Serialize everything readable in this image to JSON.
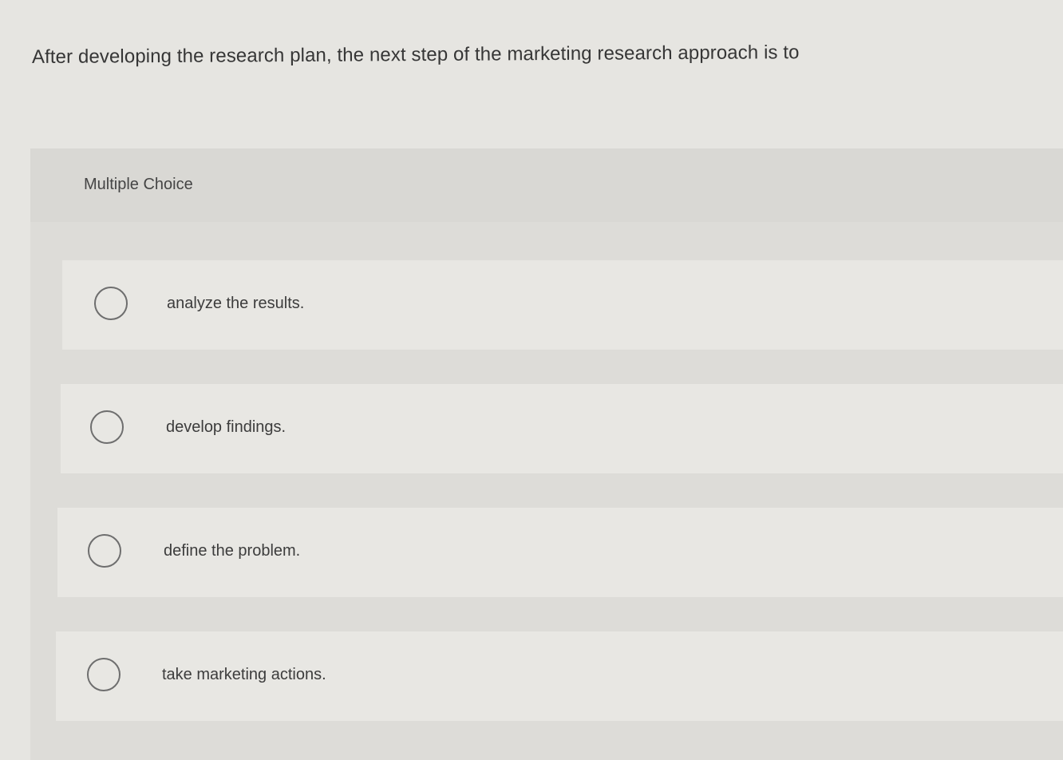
{
  "question": {
    "text": "After developing the research plan, the next step of the marketing research approach is to"
  },
  "panel": {
    "type_label": "Multiple Choice"
  },
  "choices": [
    {
      "label": "analyze the results."
    },
    {
      "label": "develop findings."
    },
    {
      "label": "define the problem."
    },
    {
      "label": "take marketing actions."
    }
  ],
  "colors": {
    "page_background": "#e6e5e1",
    "panel_background": "#dddcd8",
    "choice_background": "#e8e7e3",
    "radio_border": "#6e6e6e",
    "text": "#3a3a3a"
  },
  "icons": {
    "radio": "radio-unselected-icon"
  }
}
